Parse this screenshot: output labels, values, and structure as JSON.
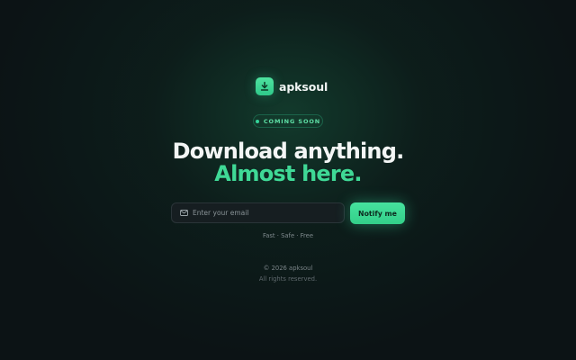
{
  "brand": {
    "name": "apksoul",
    "logo_icon": "download-icon",
    "accent_color": "#34d399"
  },
  "badge": {
    "label": "COMING SOON"
  },
  "hero": {
    "line1": "Download anything.",
    "line2": "Almost here."
  },
  "signup": {
    "email_placeholder": "Enter your email",
    "email_value": "",
    "email_icon": "mail-icon",
    "button_label": "Notify me"
  },
  "features": {
    "text": "Fast · Safe · Free"
  },
  "footer": {
    "copyright": "© 2026 apksoul",
    "rights": "All rights reserved."
  }
}
